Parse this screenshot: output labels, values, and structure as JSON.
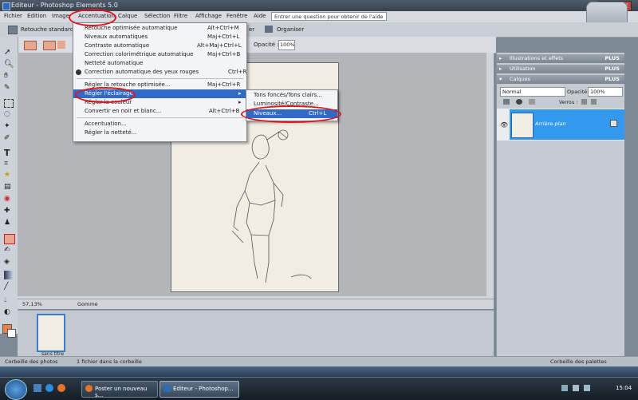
{
  "window": {
    "title": "Editeur - Photoshop Elements 5.0"
  },
  "menubar": {
    "items": [
      "Fichier",
      "Edition",
      "Image",
      "Accentuation",
      "Calque",
      "Sélection",
      "Filtre",
      "Affichage",
      "Fenêtre",
      "Aide"
    ],
    "help_placeholder": "Entrer une question pour obtenir de l'aide"
  },
  "toolbar": {
    "quick_fix": "Retouche standard",
    "layer_btn": "er",
    "organize": "Organiser"
  },
  "options_bar": {
    "opacity_label": "Opacité :",
    "opacity_value": "100%"
  },
  "accentuation_menu": {
    "items": [
      {
        "label": "Retouche optimisée automatique",
        "shortcut": "Alt+Ctrl+M"
      },
      {
        "label": "Niveaux automatiques",
        "shortcut": "Maj+Ctrl+L"
      },
      {
        "label": "Contraste automatique",
        "shortcut": "Alt+Maj+Ctrl+L"
      },
      {
        "label": "Correction colorimétrique automatique",
        "shortcut": "Maj+Ctrl+B"
      },
      {
        "label": "Netteté automatique",
        "shortcut": ""
      },
      {
        "label": "Correction automatique des yeux rouges",
        "shortcut": "Ctrl+R"
      },
      {
        "label": "Régler la retouche optimisée...",
        "shortcut": "Maj+Ctrl+R"
      },
      {
        "label": "Régler l'éclairage",
        "shortcut": ""
      },
      {
        "label": "Régler la couleur",
        "shortcut": ""
      },
      {
        "label": "Convertir en noir et blanc...",
        "shortcut": "Alt+Ctrl+B"
      },
      {
        "label": "Accentuation...",
        "shortcut": ""
      },
      {
        "label": "Régler la netteté...",
        "shortcut": ""
      }
    ]
  },
  "eclairage_submenu": {
    "items": [
      {
        "label": "Tons foncés/Tons clairs...",
        "shortcut": ""
      },
      {
        "label": "Luminosité/Contraste...",
        "shortcut": ""
      },
      {
        "label": "Niveaux...",
        "shortcut": "Ctrl+L"
      }
    ]
  },
  "status": {
    "zoom": "57,13%",
    "tool": "Gomme"
  },
  "photo_bin": {
    "thumb_label": "sans titre"
  },
  "panels": {
    "illustrations": "Illustrations et effets",
    "utilisation": "Utilisation",
    "calques": "Calques",
    "plus": "PLUS",
    "blend_mode": "Normal",
    "opacity_label": "Opacité :",
    "opacity_value": "100%",
    "lock_label": "Verrou :",
    "layer_name": "Arrière-plan"
  },
  "bottom_bar": {
    "photo_bin": "Corbeille des photos",
    "file_count": "1 fichier dans la corbeille",
    "palette_bin": "Corbeille des palettes"
  },
  "taskbar": {
    "tasks": [
      "Poster un nouveau s...",
      "Editeur - Photoshop..."
    ],
    "time": "15:04"
  }
}
